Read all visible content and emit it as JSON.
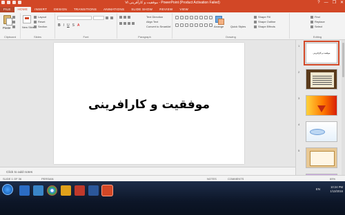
{
  "window": {
    "title": "Ⅵ موفقیت و کارآفرینی - PowerPoint (Product Activation Failed)",
    "buttons": [
      "?",
      "—",
      "❐",
      "✕"
    ]
  },
  "ribbon_tabs": [
    "FILE",
    "HOME",
    "INSERT",
    "DESIGN",
    "TRANSITIONS",
    "ANIMATIONS",
    "SLIDE SHOW",
    "REVIEW",
    "VIEW"
  ],
  "ribbon": {
    "clipboard": {
      "paste": "Paste",
      "cut": "Cut",
      "copy": "Copy",
      "format_painter": "Format Painter",
      "label": "Clipboard"
    },
    "slides": {
      "new_slide": "New Slide",
      "layout": "Layout",
      "reset": "Reset",
      "section": "Section",
      "label": "Slides"
    },
    "font": {
      "label": "Font"
    },
    "paragraph": {
      "label": "Paragraph",
      "text_direction": "Text Direction",
      "align_text": "Align Text",
      "convert": "Convert to SmartArt"
    },
    "drawing": {
      "arrange": "Arrange",
      "quick_styles": "Quick Styles",
      "shape_fill": "Shape Fill",
      "shape_outline": "Shape Outline",
      "shape_effects": "Shape Effects",
      "label": "Drawing"
    },
    "editing": {
      "find": "Find",
      "replace": "Replace",
      "select": "Select",
      "label": "Editing"
    }
  },
  "slide": {
    "title": "موفقیت و کارافرینی"
  },
  "notes": {
    "placeholder": "Click to add notes"
  },
  "thumbnails": [
    {
      "number": "1",
      "text": "موفقیت و کارافرینی"
    },
    {
      "number": "2"
    },
    {
      "number": "3"
    },
    {
      "number": "4"
    },
    {
      "number": "5"
    },
    {
      "number": "6"
    }
  ],
  "statusbar": {
    "slide_info": "SLIDE 1 OF 36",
    "language": "PERSIAN",
    "notes": "NOTES",
    "comments": "COMMENTS",
    "zoom": "69%"
  },
  "taskbar": {
    "language": "EN",
    "time": "10:24 PM",
    "date": "1/13/2016"
  },
  "colors": {
    "accent": "#d24726",
    "taskbar": "#0d1628"
  }
}
